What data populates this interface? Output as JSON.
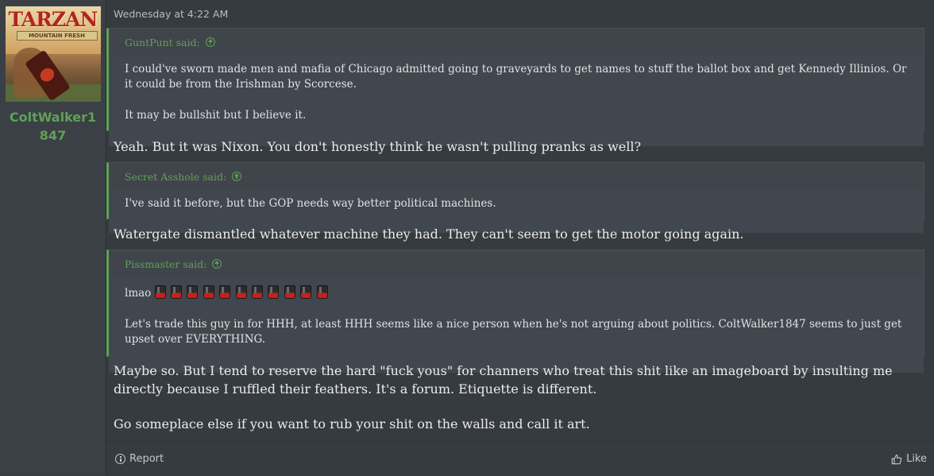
{
  "user": {
    "name": "ColtWalker1847",
    "avatar_logo": "TARZAN",
    "avatar_banner": "MOUNTAIN FRESH"
  },
  "post": {
    "timestamp": "Wednesday at 4:22 AM",
    "quotes": [
      {
        "author": "GuntPunt said:",
        "paragraphs": [
          "I could've sworn made men and mafia of Chicago admitted going to graveyards to get names to stuff the ballot box and get Kennedy Illinios. Or it could be from the Irishman by Scorcese.",
          "It may be bullshit but I believe it."
        ]
      },
      {
        "author": "Secret Asshole said:",
        "paragraphs": [
          "I've said it before, but the GOP needs way better political machines."
        ]
      },
      {
        "author": "Pissmaster said:",
        "lead_text": "lmao",
        "emoji_icon": "beer-can-icon",
        "emoji_count": 11,
        "paragraphs": [
          "Let's trade this guy in for HHH, at least HHH seems like a nice person when he's not arguing about politics. ColtWalker1847 seems to just get upset over EVERYTHING."
        ]
      }
    ],
    "replies": [
      "Yeah. But it was Nixon. You don't honestly think he wasn't pulling pranks as well?",
      "Watergate dismantled whatever machine they had. They can't seem to get the motor going again.",
      "Maybe so. But I tend to reserve the hard \"fuck yous\" for channers who treat this shit like an imageboard by insulting me directly because I ruffled their feathers. It's a forum. Etiquette is different.",
      "Go someplace else if you want to rub your shit on the walls and call it art."
    ]
  },
  "footer": {
    "report_label": "Report",
    "like_label": "Like"
  },
  "colors": {
    "accent": "#5fa155",
    "background": "#363b40",
    "quote_bg": "#41474e"
  }
}
